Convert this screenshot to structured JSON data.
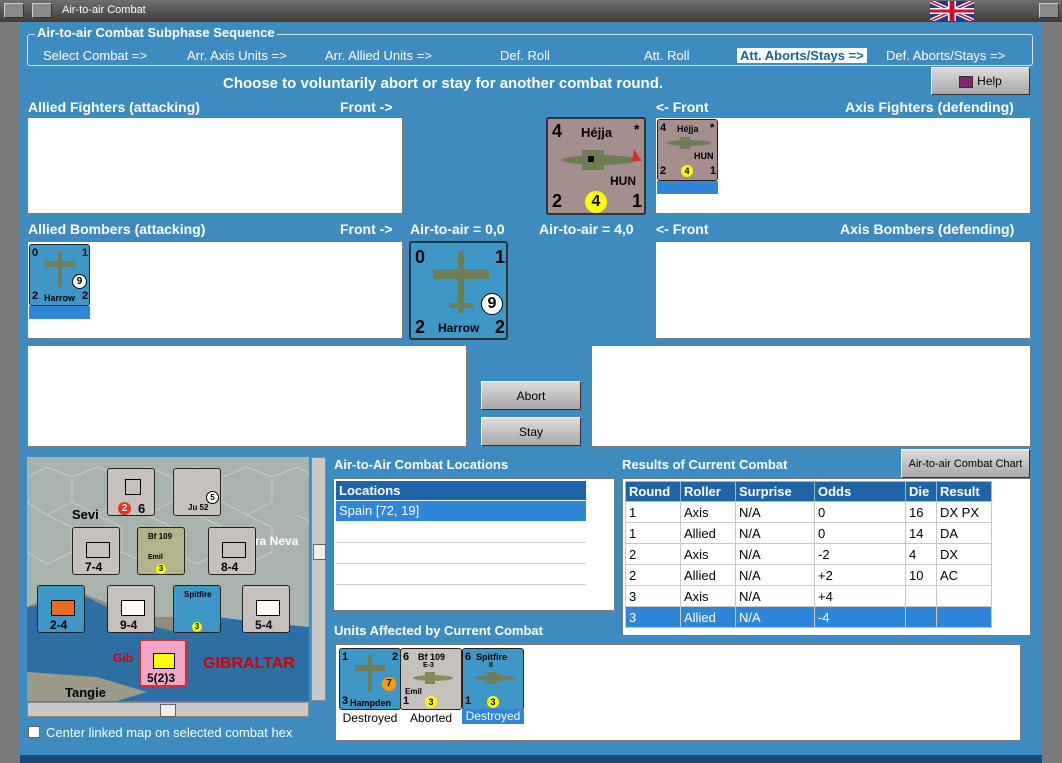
{
  "window": {
    "title": "Air-to-air Combat"
  },
  "sequence": {
    "legend": "Air-to-air Combat Subphase Sequence",
    "steps": [
      "Select Combat =>",
      "Arr. Axis Units =>",
      "Arr. Allied Units =>",
      "Def. Roll",
      "Att. Roll",
      "Att. Aborts/Stays =>",
      "Def. Aborts/Stays =>"
    ],
    "active_index": 5
  },
  "instruction": "Choose to voluntarily abort or stay for another combat round.",
  "help_label": "Help",
  "sections": {
    "allied_fighters": "Allied Fighters (attacking)",
    "front_right": "Front ->",
    "front_left": "<- Front",
    "axis_fighters": "Axis Fighters (defending)",
    "allied_bombers": "Allied Bombers (attacking)",
    "axis_bombers": "Axis Bombers (defending)",
    "allied_strength": "Air-to-air = 0,0",
    "axis_strength": "Air-to-air = 4,0"
  },
  "units": {
    "hejja": {
      "name": "Héjja",
      "nation": "HUN",
      "tl": "4",
      "bl": "2",
      "br": "1",
      "val": "4",
      "star": "*"
    },
    "harrow": {
      "name": "Harrow",
      "tl": "0",
      "tr": "1",
      "bl": "2",
      "br": "2",
      "val": "9"
    }
  },
  "buttons": {
    "abort": "Abort",
    "stay": "Stay",
    "chart": "Air-to-air Combat Chart"
  },
  "locations": {
    "title": "Air-to-Air Combat Locations",
    "header": "Locations",
    "rows": [
      "Spain [72, 19]"
    ]
  },
  "results": {
    "title": "Results of Current Combat",
    "columns": [
      "Round",
      "Roller",
      "Surprise",
      "Odds",
      "Die",
      "Result"
    ],
    "rows": [
      [
        "1",
        "Axis",
        "N/A",
        "0",
        "16",
        "DX PX"
      ],
      [
        "1",
        "Allied",
        "N/A",
        "0",
        "14",
        "DA"
      ],
      [
        "2",
        "Axis",
        "N/A",
        "-2",
        "4",
        "DX"
      ],
      [
        "2",
        "Allied",
        "N/A",
        "+2",
        "10",
        "AC"
      ],
      [
        "3",
        "Axis",
        "N/A",
        "+4",
        "",
        ""
      ],
      [
        "3",
        "Allied",
        "N/A",
        "-4",
        "",
        ""
      ]
    ],
    "selected_row": 5
  },
  "affected": {
    "title": "Units Affected by Current Combat",
    "items": [
      {
        "name": "Hampden",
        "tl": "1",
        "tr": "2",
        "bl": "3",
        "val": "7",
        "status": "Destroyed"
      },
      {
        "name": "Bf 109",
        "sub": "E-3",
        "tag": "Emil",
        "tl": "6",
        "bl": "1",
        "val": "3",
        "status": "Aborted"
      },
      {
        "name": "Spitfire",
        "sub": "II",
        "tl": "6",
        "bl": "1",
        "val": "3",
        "status": "Destroyed"
      }
    ]
  },
  "map": {
    "labels": [
      "Sevi",
      "ra Neva",
      "GIBRALTAR",
      "Gib",
      "Tangie",
      "Ju 52",
      "Bf 109",
      "Emil",
      "Spitfire"
    ],
    "counters": [
      "7-4",
      "8-4",
      "2-4",
      "9-4",
      "5-4",
      "5(2)3",
      "6",
      "5"
    ]
  },
  "center_checkbox": "Center linked map on selected combat hex",
  "colors": {
    "panel": "#3e8cbf",
    "header_blue": "#1f63a8",
    "selection": "#2f86d8",
    "axis_counter": "#a58e8e",
    "allied_counter": "#3f97c8"
  }
}
